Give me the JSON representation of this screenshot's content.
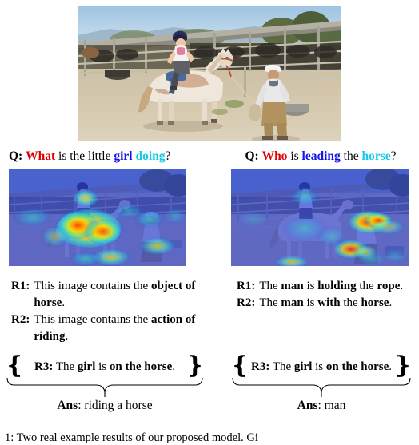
{
  "figure": {
    "photo": {
      "alt_label": "girl riding a white horse led by a man in a ranch corral"
    },
    "columns": [
      {
        "id": "left",
        "question": {
          "label": "Q:",
          "tokens": [
            {
              "text": "What",
              "color": "red"
            },
            {
              "text": "is the little",
              "color": "black"
            },
            {
              "text": "girl",
              "color": "blue"
            },
            {
              "text": "doing",
              "color": "cyan"
            },
            {
              "text": "?",
              "color": "black"
            }
          ],
          "plain": "Q: What is the little girl doing?"
        },
        "heatmap": {
          "alt_label": "attention heatmap over horse region"
        },
        "reasons": [
          {
            "tag": "R1:",
            "segments": [
              {
                "text": "This image contains the ",
                "bold": false
              },
              {
                "text": "object of horse",
                "bold": true
              },
              {
                "text": ".",
                "bold": false
              }
            ],
            "plain": "R1: This image contains the object of horse."
          },
          {
            "tag": "R2:",
            "segments": [
              {
                "text": "This image contains the ",
                "bold": false
              },
              {
                "text": "action of riding",
                "bold": true
              },
              {
                "text": ".",
                "bold": false
              }
            ],
            "plain": "R2: This image contains the action of riding."
          }
        ],
        "r3": {
          "tag": "R3:",
          "segments": [
            {
              "text": "The ",
              "bold": false
            },
            {
              "text": "girl",
              "bold": true
            },
            {
              "text": " is ",
              "bold": false
            },
            {
              "text": "on the horse",
              "bold": true
            },
            {
              "text": ".",
              "bold": false
            }
          ],
          "plain": "R3: The girl is on the horse."
        },
        "answer": {
          "label": "Ans",
          "separator": ":",
          "value": "riding a horse"
        }
      },
      {
        "id": "right",
        "question": {
          "label": "Q:",
          "tokens": [
            {
              "text": "Who",
              "color": "red"
            },
            {
              "text": "is",
              "color": "black"
            },
            {
              "text": "leading",
              "color": "blue"
            },
            {
              "text": "the",
              "color": "black"
            },
            {
              "text": "horse",
              "color": "cyan"
            },
            {
              "text": "?",
              "color": "black"
            }
          ],
          "plain": "Q: Who is leading the horse?"
        },
        "heatmap": {
          "alt_label": "attention heatmap over man region"
        },
        "reasons": [
          {
            "tag": "R1:",
            "segments": [
              {
                "text": "The ",
                "bold": false
              },
              {
                "text": "man",
                "bold": true
              },
              {
                "text": " is ",
                "bold": false
              },
              {
                "text": "holding",
                "bold": true
              },
              {
                "text": " the ",
                "bold": false
              },
              {
                "text": "rope",
                "bold": true
              },
              {
                "text": ".",
                "bold": false
              }
            ],
            "plain": "R1: The man is holding the rope."
          },
          {
            "tag": "R2:",
            "segments": [
              {
                "text": "The ",
                "bold": false
              },
              {
                "text": "man",
                "bold": true
              },
              {
                "text": " is ",
                "bold": false
              },
              {
                "text": "with",
                "bold": true
              },
              {
                "text": " the ",
                "bold": false
              },
              {
                "text": "horse",
                "bold": true
              },
              {
                "text": ".",
                "bold": false
              }
            ],
            "plain": "R2: The man is with the horse."
          }
        ],
        "r3": {
          "tag": "R3:",
          "segments": [
            {
              "text": "The ",
              "bold": false
            },
            {
              "text": "girl",
              "bold": true
            },
            {
              "text": " is ",
              "bold": false
            },
            {
              "text": "on the horse",
              "bold": true
            },
            {
              "text": ".",
              "bold": false
            }
          ],
          "plain": "R3: The girl is on the horse."
        },
        "answer": {
          "label": "Ans",
          "separator": ":",
          "value": "man"
        }
      }
    ],
    "caption": {
      "number": "1:",
      "text": "Two real example results of our proposed model. Gi"
    },
    "colors": {
      "red": "#e00000",
      "blue": "#1414e6",
      "cyan": "#19c8e6",
      "black": "#000000"
    }
  }
}
